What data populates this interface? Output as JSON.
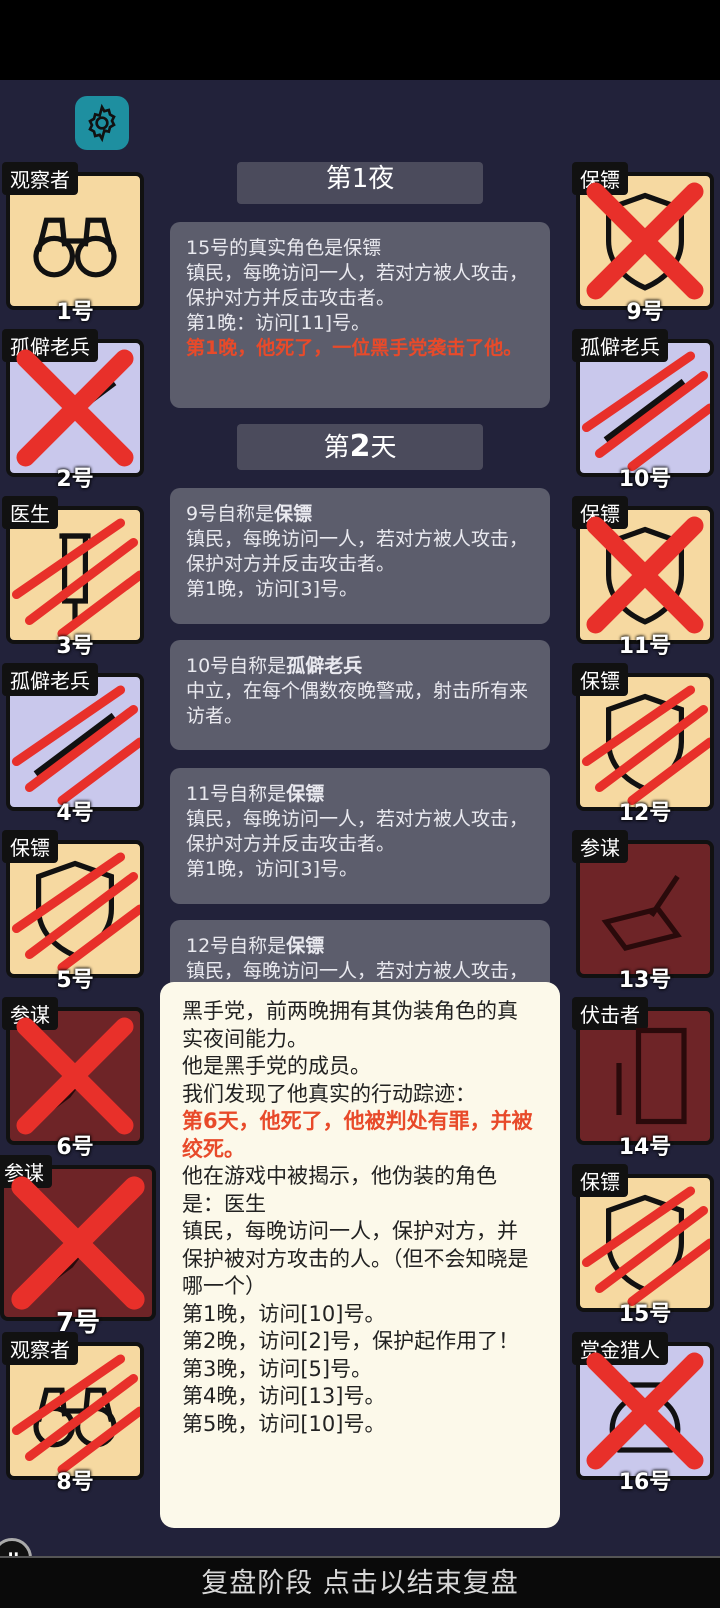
{
  "players": [
    {
      "num": "1号",
      "role": "观察者",
      "type": "t1",
      "icon": "binoculars",
      "status": "alive"
    },
    {
      "num": "2号",
      "role": "孤僻老兵",
      "type": "t2",
      "icon": "rifle",
      "status": "lynched"
    },
    {
      "num": "3号",
      "role": "医生",
      "type": "t1",
      "icon": "syringe",
      "status": "killed"
    },
    {
      "num": "4号",
      "role": "孤僻老兵",
      "type": "t2",
      "icon": "rifle",
      "status": "killed"
    },
    {
      "num": "5号",
      "role": "保镖",
      "type": "t1",
      "icon": "shield",
      "status": "killed"
    },
    {
      "num": "6号",
      "role": "参谋",
      "type": "t3",
      "icon": "quill",
      "status": "lynched"
    },
    {
      "num": "7号",
      "role": "参谋",
      "type": "t3",
      "icon": "quill",
      "status": "lynched"
    },
    {
      "num": "8号",
      "role": "观察者",
      "type": "t1",
      "icon": "binoculars",
      "status": "killed"
    },
    {
      "num": "9号",
      "role": "保镖",
      "type": "t1",
      "icon": "shield",
      "status": "lynched"
    },
    {
      "num": "10号",
      "role": "孤僻老兵",
      "type": "t2",
      "icon": "rifle",
      "status": "killed"
    },
    {
      "num": "11号",
      "role": "保镖",
      "type": "t1",
      "icon": "shield",
      "status": "lynched"
    },
    {
      "num": "12号",
      "role": "保镖",
      "type": "t1",
      "icon": "shield",
      "status": "killed"
    },
    {
      "num": "13号",
      "role": "参谋",
      "type": "t3",
      "icon": "quill",
      "status": "alive"
    },
    {
      "num": "14号",
      "role": "伏击者",
      "type": "t3",
      "icon": "knife-door",
      "status": "alive"
    },
    {
      "num": "15号",
      "role": "保镖",
      "type": "t1",
      "icon": "shield",
      "status": "killed"
    },
    {
      "num": "16号",
      "role": "赏金猎人",
      "type": "t2",
      "icon": "money-bag",
      "status": "lynched"
    }
  ],
  "feed": {
    "day1_partial": "第1夜",
    "msg1": {
      "head": "15号的真实角色是保镖",
      "body": "镇民，每晚访问一人，若对方被人攻击，保护对方并反击攻击者。",
      "visit": "第1晚：访问[11]号。",
      "death": "第1晚，他死了，一位黑手党袭击了他。"
    },
    "day2": {
      "prefix": "第",
      "num": "2",
      "suffix": "天"
    },
    "msg2": {
      "head_prefix": "9号自称是",
      "head_role": "保镖",
      "body": "镇民，每晚访问一人，若对方被人攻击，保护对方并反击攻击者。",
      "visit": "第1晚，访问[3]号。"
    },
    "msg3": {
      "head_prefix": "10号自称是",
      "head_role": "孤僻老兵",
      "body": "中立，在每个偶数夜晚警戒，射击所有来访者。"
    },
    "msg4": {
      "head_prefix": "11号自称是",
      "head_role": "保镖",
      "body": "镇民，每晚访问一人，若对方被人攻击，保护对方并反击攻击者。",
      "visit": "第1晚，访问[3]号。"
    },
    "msg5": {
      "head_prefix": "12号自称是",
      "head_role": "保镖",
      "body": "镇民，每晚访问一人，若对方被人攻击，保护对方并反击攻击者。"
    }
  },
  "popup": {
    "line1": "黑手党，前两晚拥有其伪装角色的真实夜间能力。",
    "line2": "他是黑手党的成员。",
    "line3": "我们发现了他真实的行动踪迹：",
    "death": "第6天，他死了，他被判处有罪，并被绞死。",
    "line4": "他在游戏中被揭示，他伪装的角色是：医生",
    "line5": "镇民，每晚访问一人，保护对方，并保护被对方攻击的人。（但不会知晓是哪一个）",
    "v1": "第1晚，访问[10]号。",
    "v2": "第2晚，访问[2]号，保护起作用了！",
    "v3": "第3晚，访问[5]号。",
    "v4": "第4晚，访问[13]号。",
    "v5": "第5晚，访问[10]号。"
  },
  "bottom": {
    "label": "复盘阶段 点击以结束复盘"
  },
  "colors": {
    "accent_red": "#e84a2a",
    "gear_teal": "#1e8fa0",
    "background": "#22223a"
  }
}
